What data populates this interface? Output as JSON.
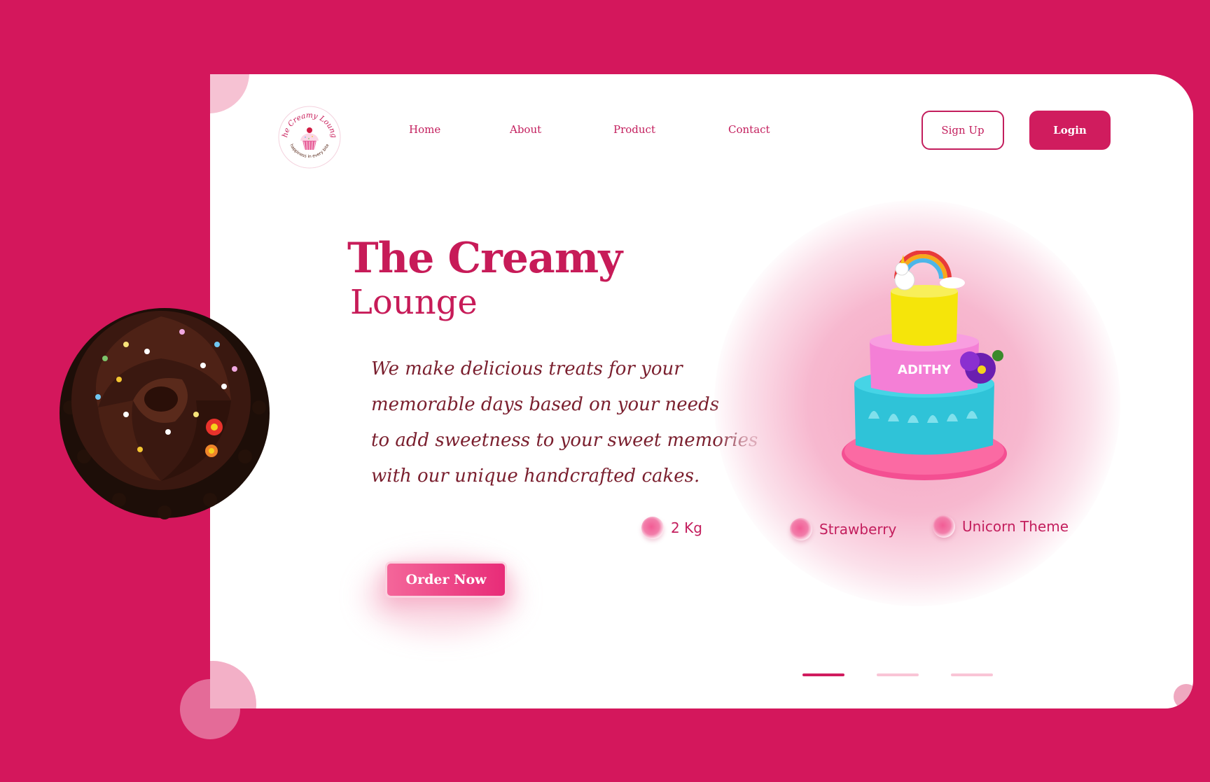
{
  "brand": {
    "logo_text_top": "The Creamy Lounge",
    "logo_text_bottom": "happiness in every bite"
  },
  "nav": {
    "links": [
      "Home",
      "About",
      "Product",
      "Contact"
    ],
    "signup_label": "Sign Up",
    "login_label": "Login"
  },
  "hero": {
    "title_line1": "The Creamy",
    "title_line2": "Lounge",
    "tagline": [
      "We make delicious treats for your",
      "memorable days based on your needs",
      "to add sweetness to your sweet memories",
      "with our unique handcrafted cakes."
    ],
    "order_label": "Order Now"
  },
  "cake": {
    "name_on_cake": "ADITHY"
  },
  "features": [
    {
      "label": "2 Kg"
    },
    {
      "label": "Strawberry"
    },
    {
      "label": "Unicorn Theme"
    }
  ],
  "carousel": {
    "slides": 3,
    "active_index": 0
  },
  "colors": {
    "background": "#d4175c",
    "primary": "#c71b58",
    "tagline": "#7a1f2e",
    "indicator_active": "#d01c5e",
    "indicator_inactive": "#f9c5d6"
  }
}
